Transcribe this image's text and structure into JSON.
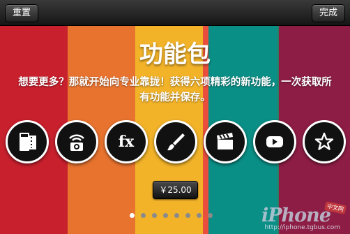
{
  "topbar": {
    "reset_label": "重置",
    "done_label": "完成"
  },
  "colors": {
    "stripes": [
      "#c8202d",
      "#e8732f",
      "#f2b329",
      "#e94f3c",
      "#0a8f86",
      "#2e7d64",
      "#8e1d45"
    ]
  },
  "content": {
    "title": "功能包",
    "description": "想要更多？那就开始向专业靠拢！获得六项精彩的新功能，一次获取所有功能并保存。"
  },
  "features": [
    {
      "icon": "film-icon"
    },
    {
      "icon": "wifi-camera-icon"
    },
    {
      "icon": "fx-icon",
      "text": "fx"
    },
    {
      "icon": "brush-icon"
    },
    {
      "icon": "clapperboard-icon"
    },
    {
      "icon": "play-icon"
    },
    {
      "icon": "star-icon"
    }
  ],
  "purchase": {
    "price_label": "￥25.00"
  },
  "pager": {
    "page_count": 8,
    "current_index": 0
  },
  "watermark": {
    "brand": "iPhone",
    "site": "http://iphone.tgbus.com",
    "tag": "中文网"
  }
}
